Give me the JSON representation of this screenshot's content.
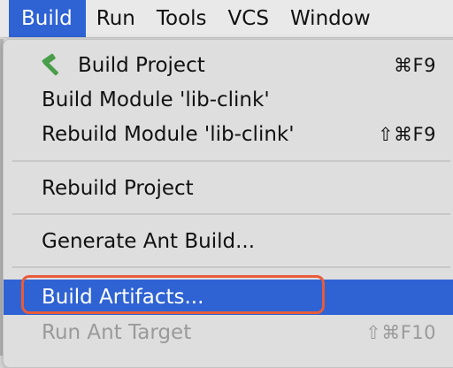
{
  "menubar": {
    "items": [
      "Build",
      "Run",
      "Tools",
      "VCS",
      "Window"
    ],
    "active": "Build"
  },
  "menu": {
    "build_project": {
      "label": "Build Project",
      "shortcut": "⌘F9",
      "icon": "hammer-icon"
    },
    "build_module": {
      "label": "Build Module 'lib-clink'"
    },
    "rebuild_module": {
      "label": "Rebuild Module 'lib-clink'",
      "shortcut": "⇧⌘F9"
    },
    "rebuild_project": {
      "label": "Rebuild Project"
    },
    "generate_ant": {
      "label": "Generate Ant Build..."
    },
    "build_artifacts": {
      "label": "Build Artifacts...",
      "state": "highlighted"
    },
    "run_ant_target": {
      "label": "Run Ant Target",
      "shortcut": "⇧⌘F10",
      "state": "disabled"
    }
  },
  "colors": {
    "accent": "#2f63d4",
    "focus_ring": "#e95b3a",
    "hammer": "#4a9e4a"
  }
}
